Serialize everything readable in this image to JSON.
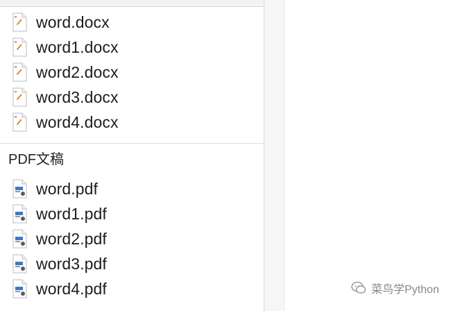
{
  "word_files": [
    {
      "name": "word.docx",
      "icon": "word-document-icon"
    },
    {
      "name": "word1.docx",
      "icon": "word-document-icon"
    },
    {
      "name": "word2.docx",
      "icon": "word-document-icon"
    },
    {
      "name": "word3.docx",
      "icon": "word-document-icon"
    },
    {
      "name": "word4.docx",
      "icon": "word-document-icon"
    }
  ],
  "pdf_section": {
    "title": "PDF文稿",
    "files": [
      {
        "name": "word.pdf",
        "icon": "pdf-document-icon"
      },
      {
        "name": "word1.pdf",
        "icon": "pdf-document-icon"
      },
      {
        "name": "word2.pdf",
        "icon": "pdf-document-icon"
      },
      {
        "name": "word3.pdf",
        "icon": "pdf-document-icon"
      },
      {
        "name": "word4.pdf",
        "icon": "pdf-document-icon"
      }
    ]
  },
  "watermark": {
    "text": "菜鸟学Python",
    "icon": "wechat-icon"
  },
  "colors": {
    "text": "#1d1d1f",
    "divider": "#d9d9d9",
    "watermark": "#888888",
    "pdf_blue": "#3f78c9"
  }
}
